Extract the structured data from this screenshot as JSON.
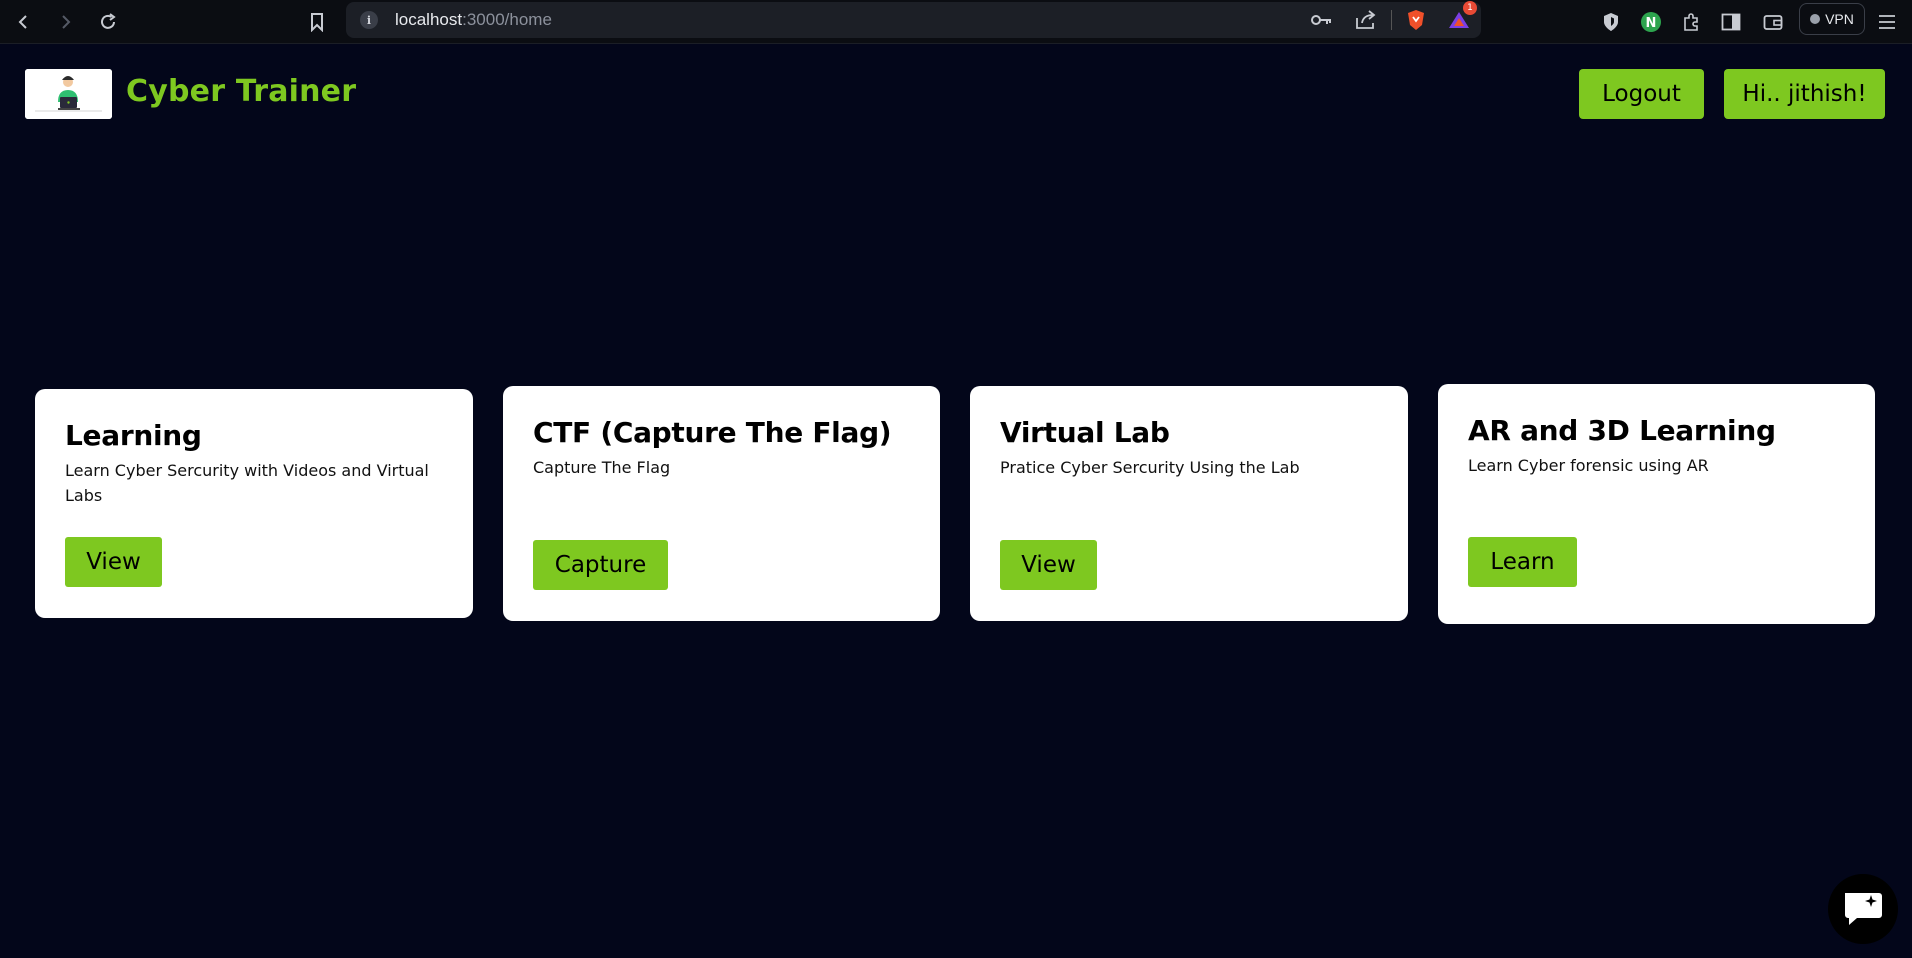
{
  "browser": {
    "url_host": "localhost",
    "url_path": ":3000/home",
    "vpn_label": "VPN",
    "notification_count": "1",
    "icons": [
      "back-icon",
      "forward-icon",
      "reload-icon",
      "bookmark-icon",
      "info-icon",
      "key-icon",
      "share-icon",
      "brave-shield-icon",
      "brave-rewards-icon",
      "shield-extension-icon",
      "n-extension-icon",
      "extensions-icon",
      "sidebar-icon",
      "wallet-icon",
      "menu-icon"
    ]
  },
  "header": {
    "brand": "Cyber Trainer",
    "logout_label": "Logout",
    "greeting_label": "Hi.. jithish!"
  },
  "cards": [
    {
      "title": "Learning",
      "description": "Learn Cyber Sercurity with Videos and Virtual Labs",
      "button": "View"
    },
    {
      "title": "CTF (Capture The Flag)",
      "description": "Capture The Flag",
      "button": "Capture"
    },
    {
      "title": "Virtual Lab",
      "description": "Pratice Cyber Sercurity Using the Lab",
      "button": "View"
    },
    {
      "title": "AR and 3D Learning",
      "description": "Learn Cyber forensic using AR",
      "button": "Learn"
    }
  ],
  "colors": {
    "background": "#03061a",
    "accent": "#7ec820",
    "card": "#ffffff"
  }
}
